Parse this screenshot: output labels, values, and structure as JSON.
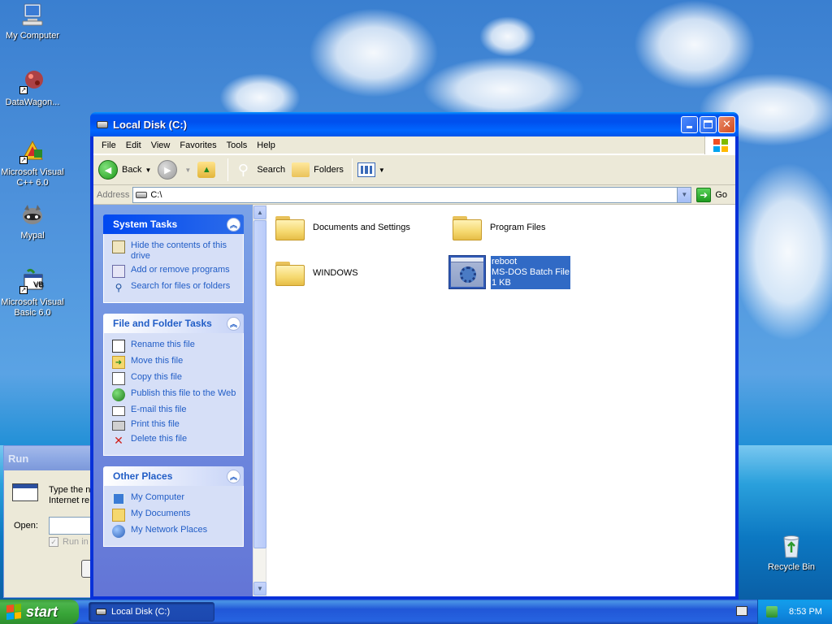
{
  "desktop": {
    "icons": [
      {
        "label": "My Computer"
      },
      {
        "label": "DataWagon..."
      },
      {
        "label": "Microsoft Visual C++ 6.0"
      },
      {
        "label": "Mypal"
      },
      {
        "label": "Microsoft Visual Basic 6.0"
      },
      {
        "label": "Recycle Bin"
      }
    ]
  },
  "run_dialog": {
    "title": "Run",
    "desc_line1": "Type the n",
    "desc_line2": "Internet re",
    "open_label": "Open:",
    "checkbox_label": "Run in"
  },
  "window": {
    "title": "Local Disk (C:)",
    "menu": [
      "File",
      "Edit",
      "View",
      "Favorites",
      "Tools",
      "Help"
    ],
    "toolbar": {
      "back": "Back",
      "search": "Search",
      "folders": "Folders"
    },
    "address": {
      "label": "Address",
      "value": "C:\\",
      "go": "Go"
    }
  },
  "task_pane": {
    "system_tasks": {
      "title": "System Tasks",
      "items": [
        {
          "label": "Hide the contents of this drive"
        },
        {
          "label": "Add or remove programs"
        },
        {
          "label": "Search for files or folders"
        }
      ]
    },
    "file_folder_tasks": {
      "title": "File and Folder Tasks",
      "items": [
        {
          "label": "Rename this file"
        },
        {
          "label": "Move this file"
        },
        {
          "label": "Copy this file"
        },
        {
          "label": "Publish this file to the Web"
        },
        {
          "label": "E-mail this file"
        },
        {
          "label": "Print this file"
        },
        {
          "label": "Delete this file"
        }
      ]
    },
    "other_places": {
      "title": "Other Places",
      "items": [
        {
          "label": "My Computer"
        },
        {
          "label": "My Documents"
        },
        {
          "label": "My Network Places"
        }
      ]
    }
  },
  "files": [
    {
      "name": "Documents and Settings",
      "type": "folder"
    },
    {
      "name": "Program Files",
      "type": "folder"
    },
    {
      "name": "WINDOWS",
      "type": "folder"
    },
    {
      "name": "reboot",
      "type": "batch",
      "kind": "MS-DOS Batch File",
      "size": "1 KB",
      "selected": true
    }
  ],
  "taskbar": {
    "start": "start",
    "task_button": "Local Disk (C:)",
    "clock": "8:53 PM"
  },
  "colors": {
    "title_blue": "#0053ee",
    "task_link": "#215dc6",
    "selection": "#316ac5",
    "start_green": "#37a437"
  }
}
